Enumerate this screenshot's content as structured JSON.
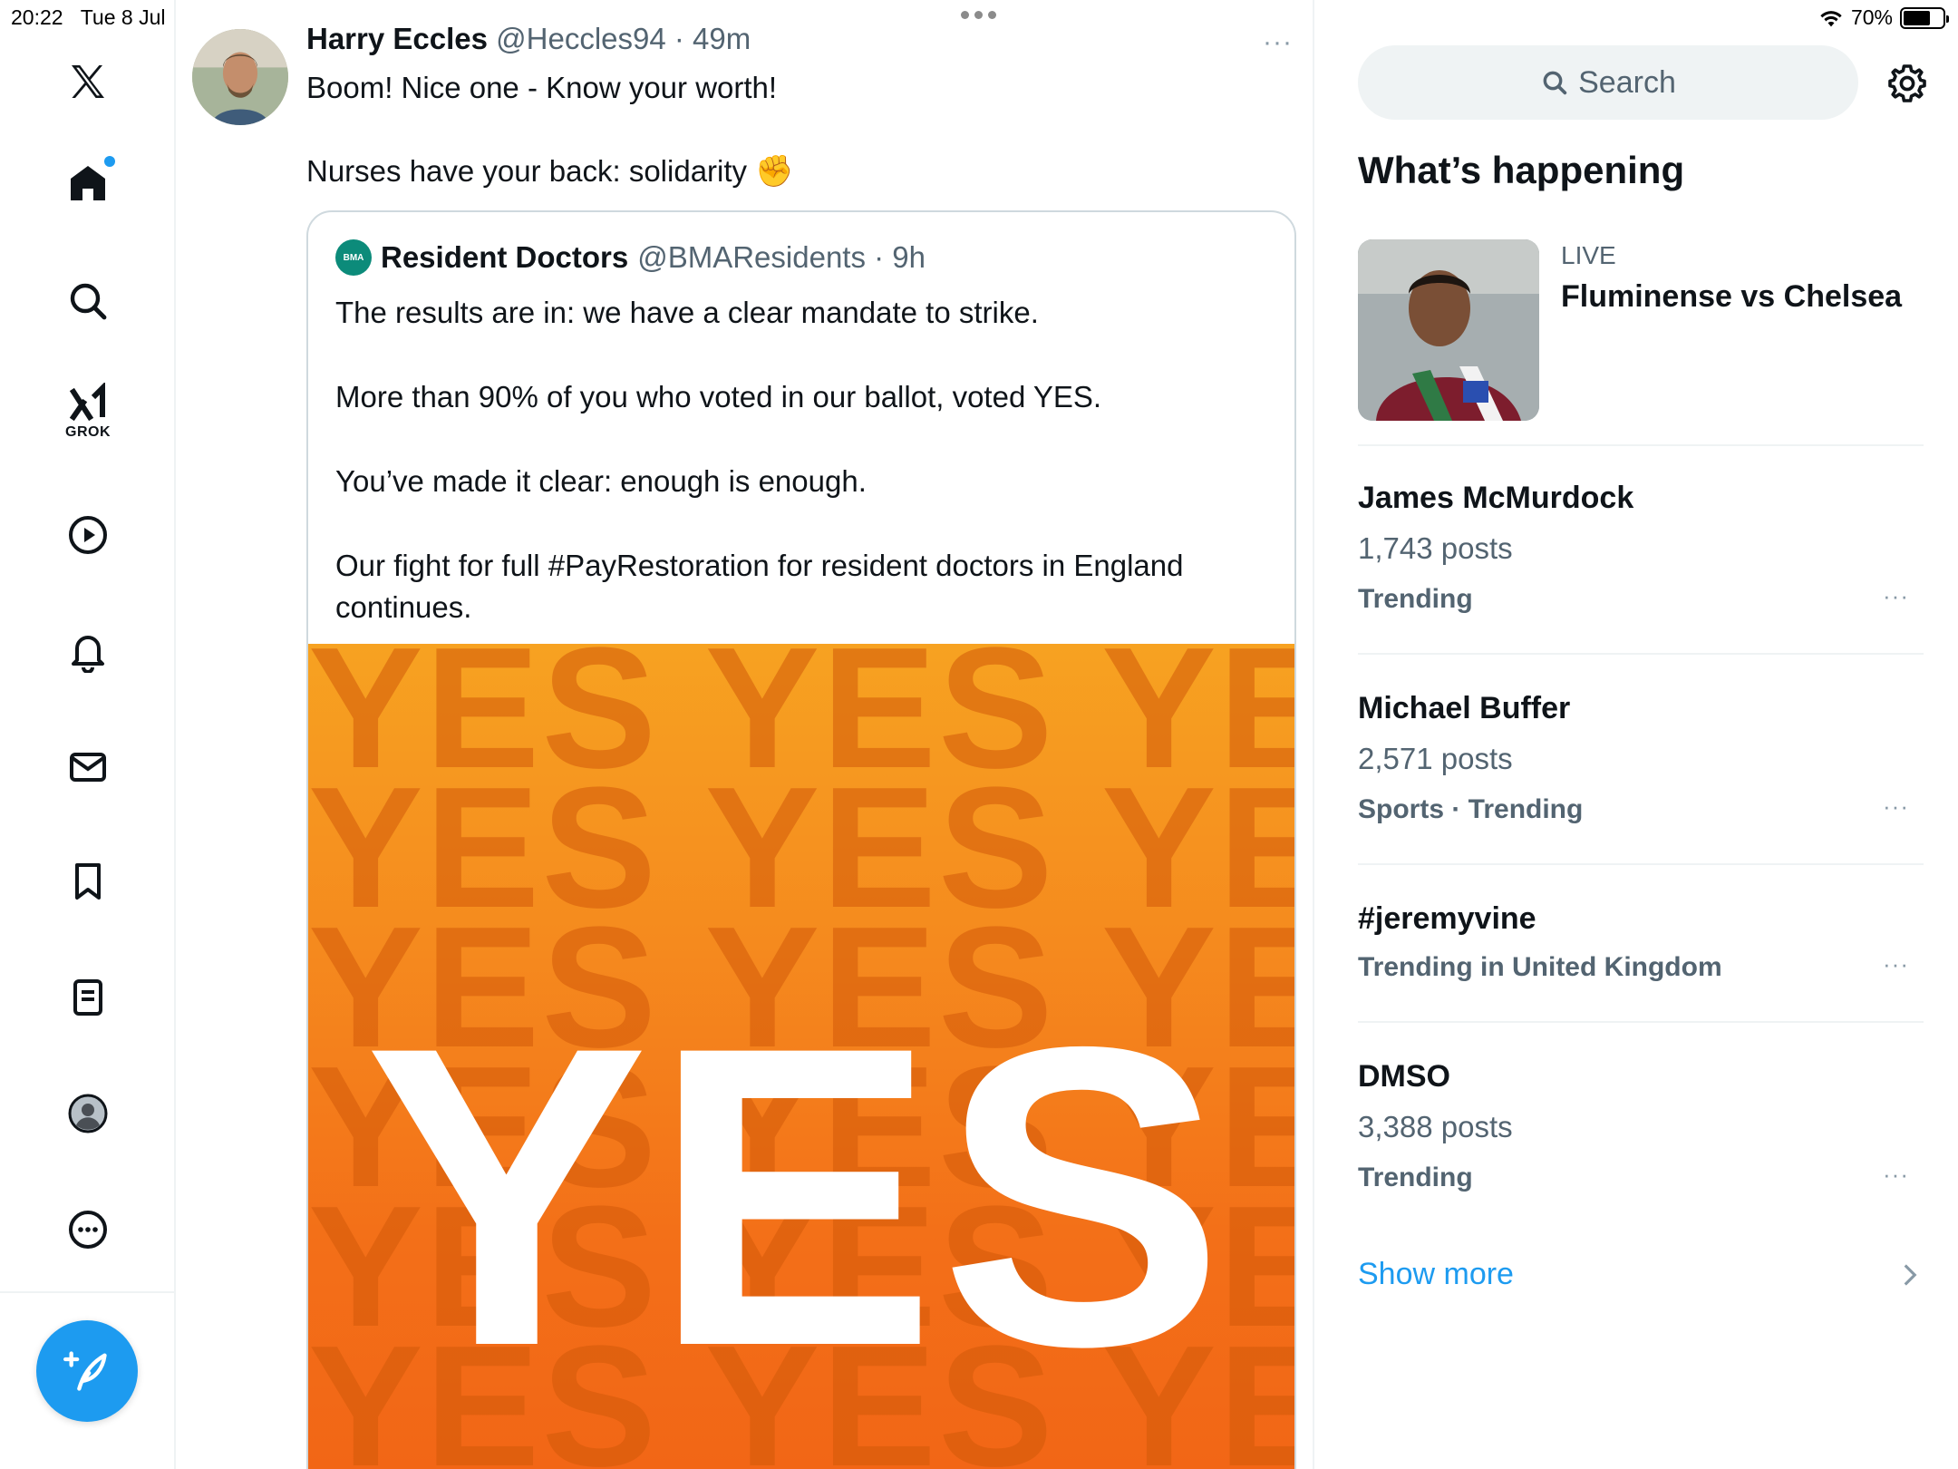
{
  "status_bar": {
    "time": "20:22",
    "date": "Tue 8 Jul",
    "battery_percent": "70%",
    "battery_level": 0.7
  },
  "nav": {
    "items": [
      {
        "icon": "x-logo-icon"
      },
      {
        "icon": "home-icon"
      },
      {
        "icon": "search-icon"
      },
      {
        "icon": "grok-icon",
        "label": "GROK"
      },
      {
        "icon": "video-play-icon"
      },
      {
        "icon": "bell-icon"
      },
      {
        "icon": "mail-icon"
      },
      {
        "icon": "bookmark-icon"
      },
      {
        "icon": "lists-icon"
      },
      {
        "icon": "profile-icon"
      },
      {
        "icon": "more-circle-icon"
      }
    ],
    "compose_icon": "compose-feather-icon"
  },
  "tweet": {
    "name": "Harry Eccles",
    "meta": "@Heccles94 · 49m",
    "line1": "Boom! Nice one - Know your worth!",
    "line2": "Nurses have your back: solidarity",
    "emoji": "✊",
    "more": "···"
  },
  "quote": {
    "logo_text": "BMA",
    "name": "Resident Doctors",
    "meta": "@BMAResidents · 9h",
    "paragraphs": [
      "The results are in: we have a clear mandate to strike.",
      "More than 90% of you who voted in our ballot, voted YES.",
      "You’ve made it clear: enough is enough.",
      "Our fight for full #PayRestoration for resident doctors in England continues."
    ],
    "image_text": "YES",
    "image_bg_text": "YES YES YES"
  },
  "sidebar": {
    "search_placeholder": "Search",
    "heading": "What’s happening",
    "live": {
      "label": "LIVE",
      "title": "Fluminense vs Chelsea"
    },
    "trends": [
      {
        "title": "James McMurdock",
        "posts": "1,743 posts",
        "sub": "Trending"
      },
      {
        "title": "Michael Buffer",
        "posts": "2,571 posts",
        "sub": "Sports · Trending"
      },
      {
        "title": "#jeremyvine",
        "posts": "",
        "sub": "Trending in United Kingdom"
      },
      {
        "title": "DMSO",
        "posts": "3,388 posts",
        "sub": "Trending"
      }
    ],
    "more_dots": "···",
    "show_more": "Show more"
  },
  "colors": {
    "accent": "#1d9bf0",
    "text_primary": "#0f1419",
    "text_secondary": "#536471",
    "image_orange": "#f58a1e"
  }
}
